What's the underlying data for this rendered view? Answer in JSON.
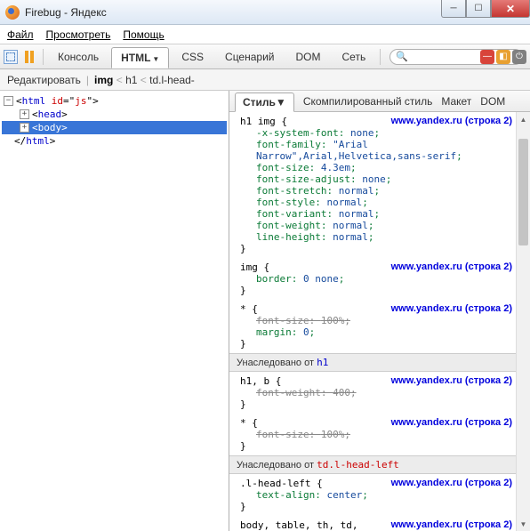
{
  "window": {
    "title": "Firebug - Яндекс"
  },
  "menu": {
    "file": "Файл",
    "view": "Просмотреть",
    "help": "Помощь"
  },
  "toolbar": {
    "console": "Консоль",
    "html": "HTML",
    "css": "CSS",
    "script": "Сценарий",
    "dom": "DOM",
    "net": "Сеть"
  },
  "sub": {
    "edit": "Редактировать",
    "crumb1": "img",
    "crumb2": "h1",
    "crumb3": "td.l-head-"
  },
  "tree": {
    "r0": "<html id=\"js\">",
    "r1": "<head>",
    "r2": "<body>",
    "r3": "</html>"
  },
  "right_tabs": {
    "style": "Стиль",
    "computed": "Скомпилированный стиль",
    "layout": "Макет",
    "dom": "DOM"
  },
  "css": {
    "src": "www.yandex.ru (строка 2)",
    "inh_label": "Унаследовано от",
    "r1_sel": "h1 img",
    "r1_p": [
      "-x-system-font: none;",
      "font-family: \"Arial Narrow\",Arial,Helvetica,sans-serif;",
      "font-size: 4.3em;",
      "font-size-adjust: none;",
      "font-stretch: normal;",
      "font-style: normal;",
      "font-variant: normal;",
      "font-weight: normal;",
      "line-height: normal;"
    ],
    "r2_sel": "img",
    "r2_p": [
      "border: 0 none;"
    ],
    "r3_sel": "*",
    "r3_p_s": [
      "font-size: 100%;"
    ],
    "r3_p": [
      "margin: 0;"
    ],
    "inh1_from": "h1",
    "r4_sel": "h1, b",
    "r4_p_s": [
      "font-weight: 400;"
    ],
    "r5_sel": "*",
    "r5_p_s": [
      "font-size: 100%;"
    ],
    "inh2_from": "td.l-head-left",
    "r6_sel": ".l-head-left",
    "r6_p": [
      "text-align: center;"
    ],
    "r7_sel": "body, table, th, td,"
  }
}
